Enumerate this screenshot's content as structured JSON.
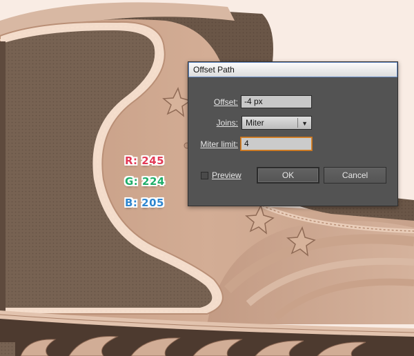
{
  "rgb_labels": {
    "r": "R: 245",
    "g": "G: 224",
    "b": "B: 205"
  },
  "dialog": {
    "title": "Offset Path",
    "offset_label": "Offset:",
    "offset_value": "-4 px",
    "joins_label": "Joins:",
    "joins_value": "Miter",
    "miter_label": "Miter limit:",
    "miter_value": "4",
    "preview_label": "Preview",
    "preview_checked": false,
    "ok_label": "OK",
    "cancel_label": "Cancel"
  },
  "colors": {
    "r_label": "#e23a56",
    "g_label": "#1fae6a",
    "b_label": "#2f86cf",
    "dialog_bg": "#535353",
    "boot_light": "#f5e0cd",
    "boot_mid": "#cfa88f",
    "panel_dark": "#766150"
  }
}
